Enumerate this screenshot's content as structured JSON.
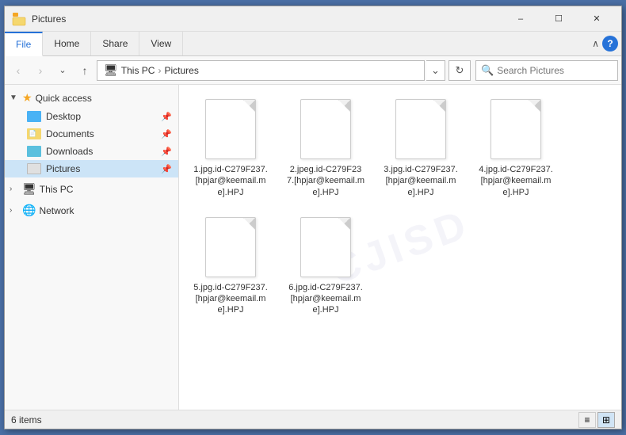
{
  "titleBar": {
    "title": "Pictures",
    "minimizeLabel": "–",
    "maximizeLabel": "☐",
    "closeLabel": "✕"
  },
  "ribbon": {
    "tabs": [
      "File",
      "Home",
      "Share",
      "View"
    ],
    "activeTab": "File"
  },
  "addressBar": {
    "backTooltip": "Back",
    "forwardTooltip": "Forward",
    "upTooltip": "Up",
    "pathParts": [
      "This PC",
      "Pictures"
    ],
    "searchPlaceholder": "Search Pictures",
    "refreshTooltip": "Refresh"
  },
  "sidebar": {
    "quickAccessLabel": "Quick access",
    "items": [
      {
        "label": "Desktop",
        "type": "desktop",
        "pinned": true
      },
      {
        "label": "Documents",
        "type": "docs",
        "pinned": true
      },
      {
        "label": "Downloads",
        "type": "downloads",
        "pinned": true
      },
      {
        "label": "Pictures",
        "type": "pictures",
        "pinned": true,
        "active": true
      }
    ],
    "thisPCLabel": "This PC",
    "networkLabel": "Network"
  },
  "files": [
    {
      "name": "1.jpg.id-C279F237.[hpjar@keemail.me].HPJ"
    },
    {
      "name": "2.jpeg.id-C279F237.[hpjar@keemail.me].HPJ"
    },
    {
      "name": "3.jpg.id-C279F237.[hpjar@keemail.me].HPJ"
    },
    {
      "name": "4.jpg.id-C279F237.[hpjar@keemail.me].HPJ"
    },
    {
      "name": "5.jpg.id-C279F237.[hpjar@keemail.me].HPJ"
    },
    {
      "name": "6.jpg.id-C279F237.[hpjar@keemail.me].HPJ"
    }
  ],
  "statusBar": {
    "itemCount": "6 items"
  },
  "watermarkText": "CJISD"
}
